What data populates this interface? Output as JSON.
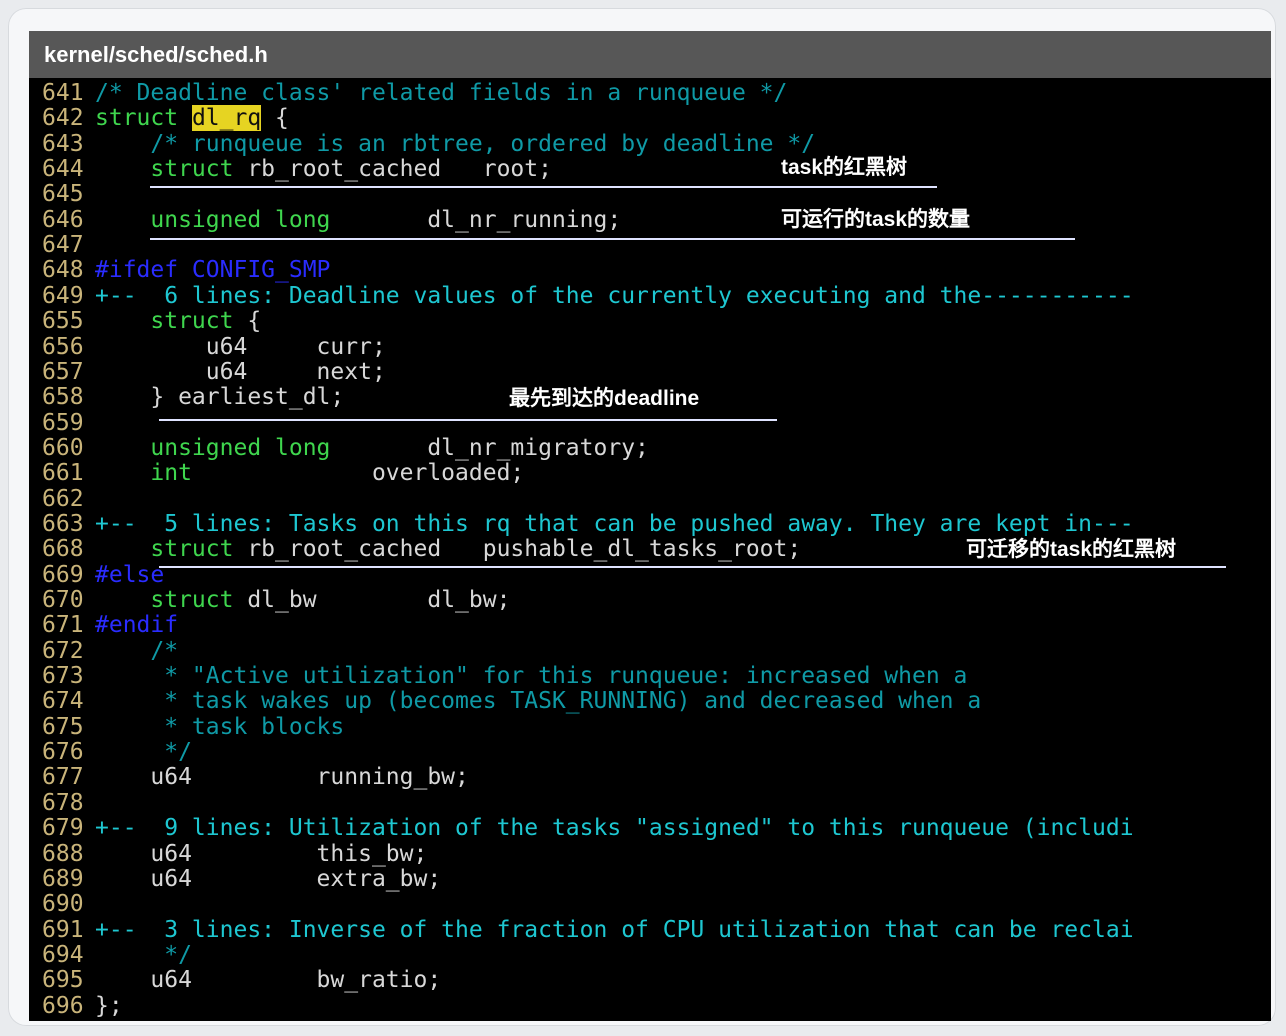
{
  "window": {
    "title": "kernel/sched/sched.h"
  },
  "colors": {
    "default": "#d8d8d8",
    "keyword": "#3fd64e",
    "comment": "#0f9aa6",
    "preproc": "#2a2cff",
    "fold": "#1ec7d1",
    "search_highlight": "#e6d422",
    "line_number": "#c9b47a"
  },
  "code_lines": [
    {
      "num": "641",
      "tokens": [
        {
          "t": "/* Deadline class' related fields in a runqueue */",
          "c": "comment"
        }
      ]
    },
    {
      "num": "642",
      "tokens": [
        {
          "t": "struct",
          "c": "keyword"
        },
        {
          "t": " ",
          "c": "default"
        },
        {
          "t": "dl_rq",
          "c": "search"
        },
        {
          "t": " {",
          "c": "default"
        }
      ]
    },
    {
      "num": "643",
      "tokens": [
        {
          "t": "    /* runqueue is an rbtree, ordered by deadline */",
          "c": "comment"
        }
      ]
    },
    {
      "num": "644",
      "tokens": [
        {
          "t": "    ",
          "c": "default"
        },
        {
          "t": "struct",
          "c": "keyword"
        },
        {
          "t": " rb_root_cached   root;",
          "c": "default"
        }
      ]
    },
    {
      "num": "645",
      "tokens": []
    },
    {
      "num": "646",
      "tokens": [
        {
          "t": "    ",
          "c": "default"
        },
        {
          "t": "unsigned long",
          "c": "keyword"
        },
        {
          "t": "       dl_nr_running;",
          "c": "default"
        }
      ]
    },
    {
      "num": "647",
      "tokens": []
    },
    {
      "num": "648",
      "tokens": [
        {
          "t": "#ifdef CONFIG_SMP",
          "c": "preproc"
        }
      ]
    },
    {
      "num": "649",
      "tokens": [
        {
          "t": "+--  6 lines: Deadline values of the currently executing and the-----------",
          "c": "fold"
        }
      ]
    },
    {
      "num": "655",
      "tokens": [
        {
          "t": "    ",
          "c": "default"
        },
        {
          "t": "struct",
          "c": "keyword"
        },
        {
          "t": " {",
          "c": "default"
        }
      ]
    },
    {
      "num": "656",
      "tokens": [
        {
          "t": "        u64     curr;",
          "c": "default"
        }
      ]
    },
    {
      "num": "657",
      "tokens": [
        {
          "t": "        u64     next;",
          "c": "default"
        }
      ]
    },
    {
      "num": "658",
      "tokens": [
        {
          "t": "    } earliest_dl;",
          "c": "default"
        }
      ]
    },
    {
      "num": "659",
      "tokens": []
    },
    {
      "num": "660",
      "tokens": [
        {
          "t": "    ",
          "c": "default"
        },
        {
          "t": "unsigned long",
          "c": "keyword"
        },
        {
          "t": "       dl_nr_migratory;",
          "c": "default"
        }
      ]
    },
    {
      "num": "661",
      "tokens": [
        {
          "t": "    ",
          "c": "default"
        },
        {
          "t": "int",
          "c": "keyword"
        },
        {
          "t": "             overloaded;",
          "c": "default"
        }
      ]
    },
    {
      "num": "662",
      "tokens": []
    },
    {
      "num": "663",
      "tokens": [
        {
          "t": "+--  5 lines: Tasks on this rq that can be pushed away. They are kept in---",
          "c": "fold"
        }
      ]
    },
    {
      "num": "668",
      "tokens": [
        {
          "t": "    ",
          "c": "default"
        },
        {
          "t": "struct",
          "c": "keyword"
        },
        {
          "t": " rb_root_cached   pushable_dl_tasks_root;",
          "c": "default"
        }
      ]
    },
    {
      "num": "669",
      "tokens": [
        {
          "t": "#else",
          "c": "preproc"
        }
      ]
    },
    {
      "num": "670",
      "tokens": [
        {
          "t": "    ",
          "c": "default"
        },
        {
          "t": "struct",
          "c": "keyword"
        },
        {
          "t": " dl_bw        dl_bw;",
          "c": "default"
        }
      ]
    },
    {
      "num": "671",
      "tokens": [
        {
          "t": "#endif",
          "c": "preproc"
        }
      ]
    },
    {
      "num": "672",
      "tokens": [
        {
          "t": "    /*",
          "c": "comment"
        }
      ]
    },
    {
      "num": "673",
      "tokens": [
        {
          "t": "     * \"Active utilization\" for this runqueue: increased when a",
          "c": "comment"
        }
      ]
    },
    {
      "num": "674",
      "tokens": [
        {
          "t": "     * task wakes up (becomes TASK_RUNNING) and decreased when a",
          "c": "comment"
        }
      ]
    },
    {
      "num": "675",
      "tokens": [
        {
          "t": "     * task blocks",
          "c": "comment"
        }
      ]
    },
    {
      "num": "676",
      "tokens": [
        {
          "t": "     */",
          "c": "comment"
        }
      ]
    },
    {
      "num": "677",
      "tokens": [
        {
          "t": "    u64         running_bw;",
          "c": "default"
        }
      ]
    },
    {
      "num": "678",
      "tokens": []
    },
    {
      "num": "679",
      "tokens": [
        {
          "t": "+--  9 lines: Utilization of the tasks \"assigned\" to this runqueue (includi",
          "c": "fold"
        }
      ]
    },
    {
      "num": "688",
      "tokens": [
        {
          "t": "    u64         this_bw;",
          "c": "default"
        }
      ]
    },
    {
      "num": "689",
      "tokens": [
        {
          "t": "    u64         extra_bw;",
          "c": "default"
        }
      ]
    },
    {
      "num": "690",
      "tokens": []
    },
    {
      "num": "691",
      "tokens": [
        {
          "t": "+--  3 lines: Inverse of the fraction of CPU utilization that can be reclai",
          "c": "fold"
        }
      ]
    },
    {
      "num": "694",
      "tokens": [
        {
          "t": "     */",
          "c": "comment"
        }
      ]
    },
    {
      "num": "695",
      "tokens": [
        {
          "t": "    u64         bw_ratio;",
          "c": "default"
        }
      ]
    },
    {
      "num": "696",
      "tokens": [
        {
          "t": "};",
          "c": "default"
        }
      ]
    }
  ],
  "annotations": [
    {
      "id": "root",
      "text": "task的红黑树"
    },
    {
      "id": "running",
      "text": "可运行的task的数量"
    },
    {
      "id": "earliest",
      "text": "最先到达的deadline"
    },
    {
      "id": "pushable",
      "text": "可迁移的task的红黑树"
    }
  ]
}
